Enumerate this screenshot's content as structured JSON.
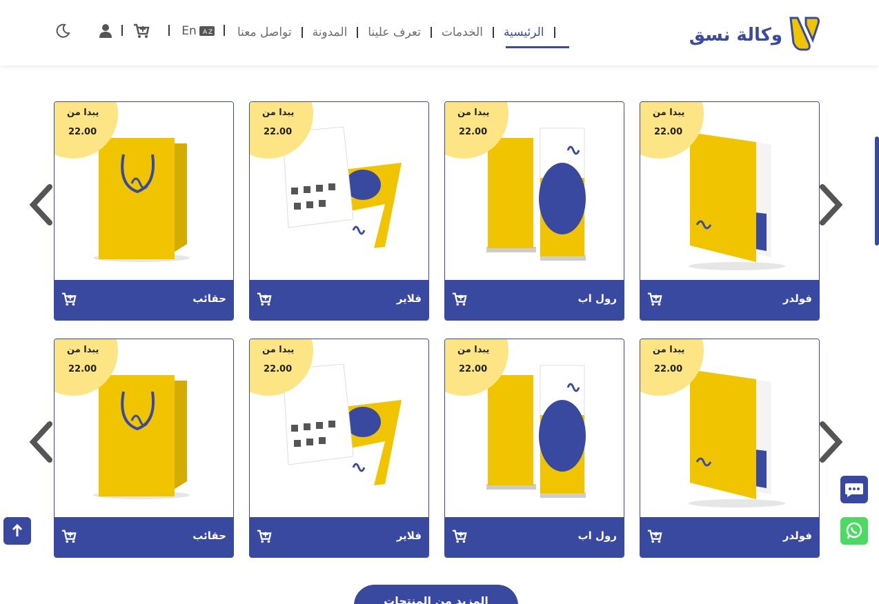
{
  "header": {
    "logo_text": "وكالة نسق",
    "nav": [
      {
        "label": "الرئيسية",
        "active": true
      },
      {
        "label": "الخدمات"
      },
      {
        "label": "تعرف علينا"
      },
      {
        "label": "المدونة"
      },
      {
        "label": "تواصل معنا"
      }
    ],
    "lang_label": "En",
    "icons": [
      "moon-icon",
      "user-icon",
      "cart-icon",
      "translate-icon"
    ]
  },
  "products": {
    "badge_label": "يبدا من",
    "rows": [
      [
        {
          "title": "فولدر",
          "price": "22.00",
          "image": "folder"
        },
        {
          "title": "رول اب",
          "price": "22.00",
          "image": "rollup"
        },
        {
          "title": "فلاير",
          "price": "22.00",
          "image": "flyer"
        },
        {
          "title": "حقائب",
          "price": "22.00",
          "image": "bag"
        }
      ],
      [
        {
          "title": "فولدر",
          "price": "22.00",
          "image": "folder"
        },
        {
          "title": "رول اب",
          "price": "22.00",
          "image": "rollup"
        },
        {
          "title": "فلاير",
          "price": "22.00",
          "image": "flyer"
        },
        {
          "title": "حقائب",
          "price": "22.00",
          "image": "bag"
        }
      ]
    ]
  },
  "more_button": "المزيد من المنتجات",
  "colors": {
    "primary": "#3949a0",
    "accent": "#fde585",
    "product_yellow": "#f0c400",
    "whatsapp": "#4cd964"
  }
}
